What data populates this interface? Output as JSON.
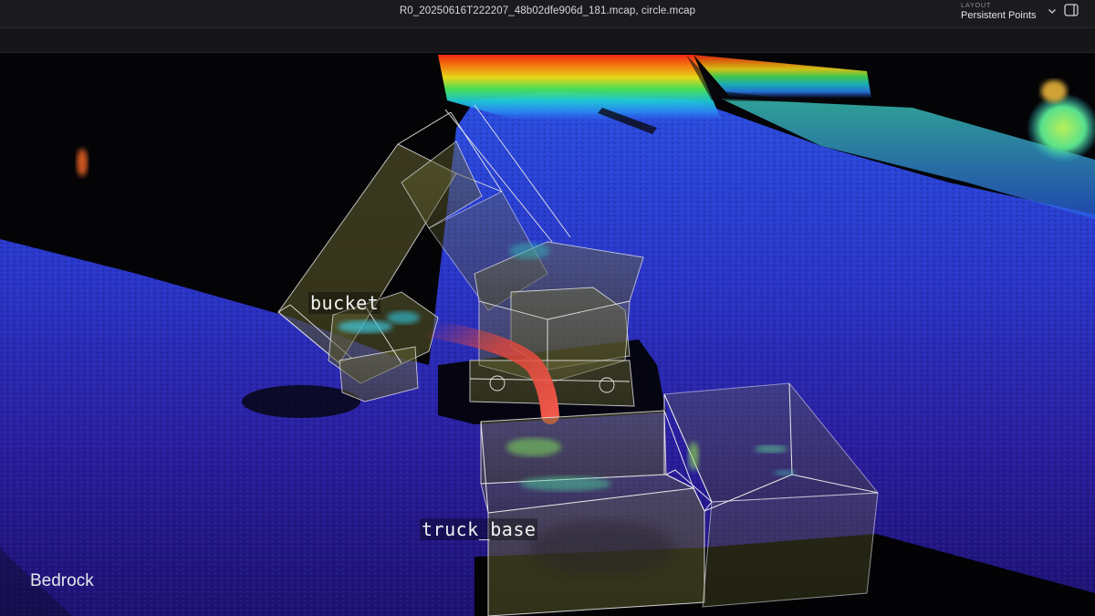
{
  "titlebar": {
    "title": "R0_20250616T222207_48b02dfe906d_181.mcap, circle.mcap",
    "layout_caption": "LAYOUT",
    "layout_value": "Persistent Points"
  },
  "scene": {
    "labels": {
      "bucket": "bucket",
      "truck_base": "truck_base"
    }
  },
  "watermark": "Bedrock",
  "icons": {
    "layout_dropdown": "chevron-down-icon",
    "sidebar_toggle": "sidebar-panel-icon"
  },
  "colors": {
    "titlebar_bg": "#1b1b1e",
    "ground_deep": "#1a1380",
    "ground_mid": "#2a3bd0",
    "cloud_hot": "#ff3b1e",
    "box_wire": "#e6e6e6",
    "trajectory": "#e8463a"
  }
}
